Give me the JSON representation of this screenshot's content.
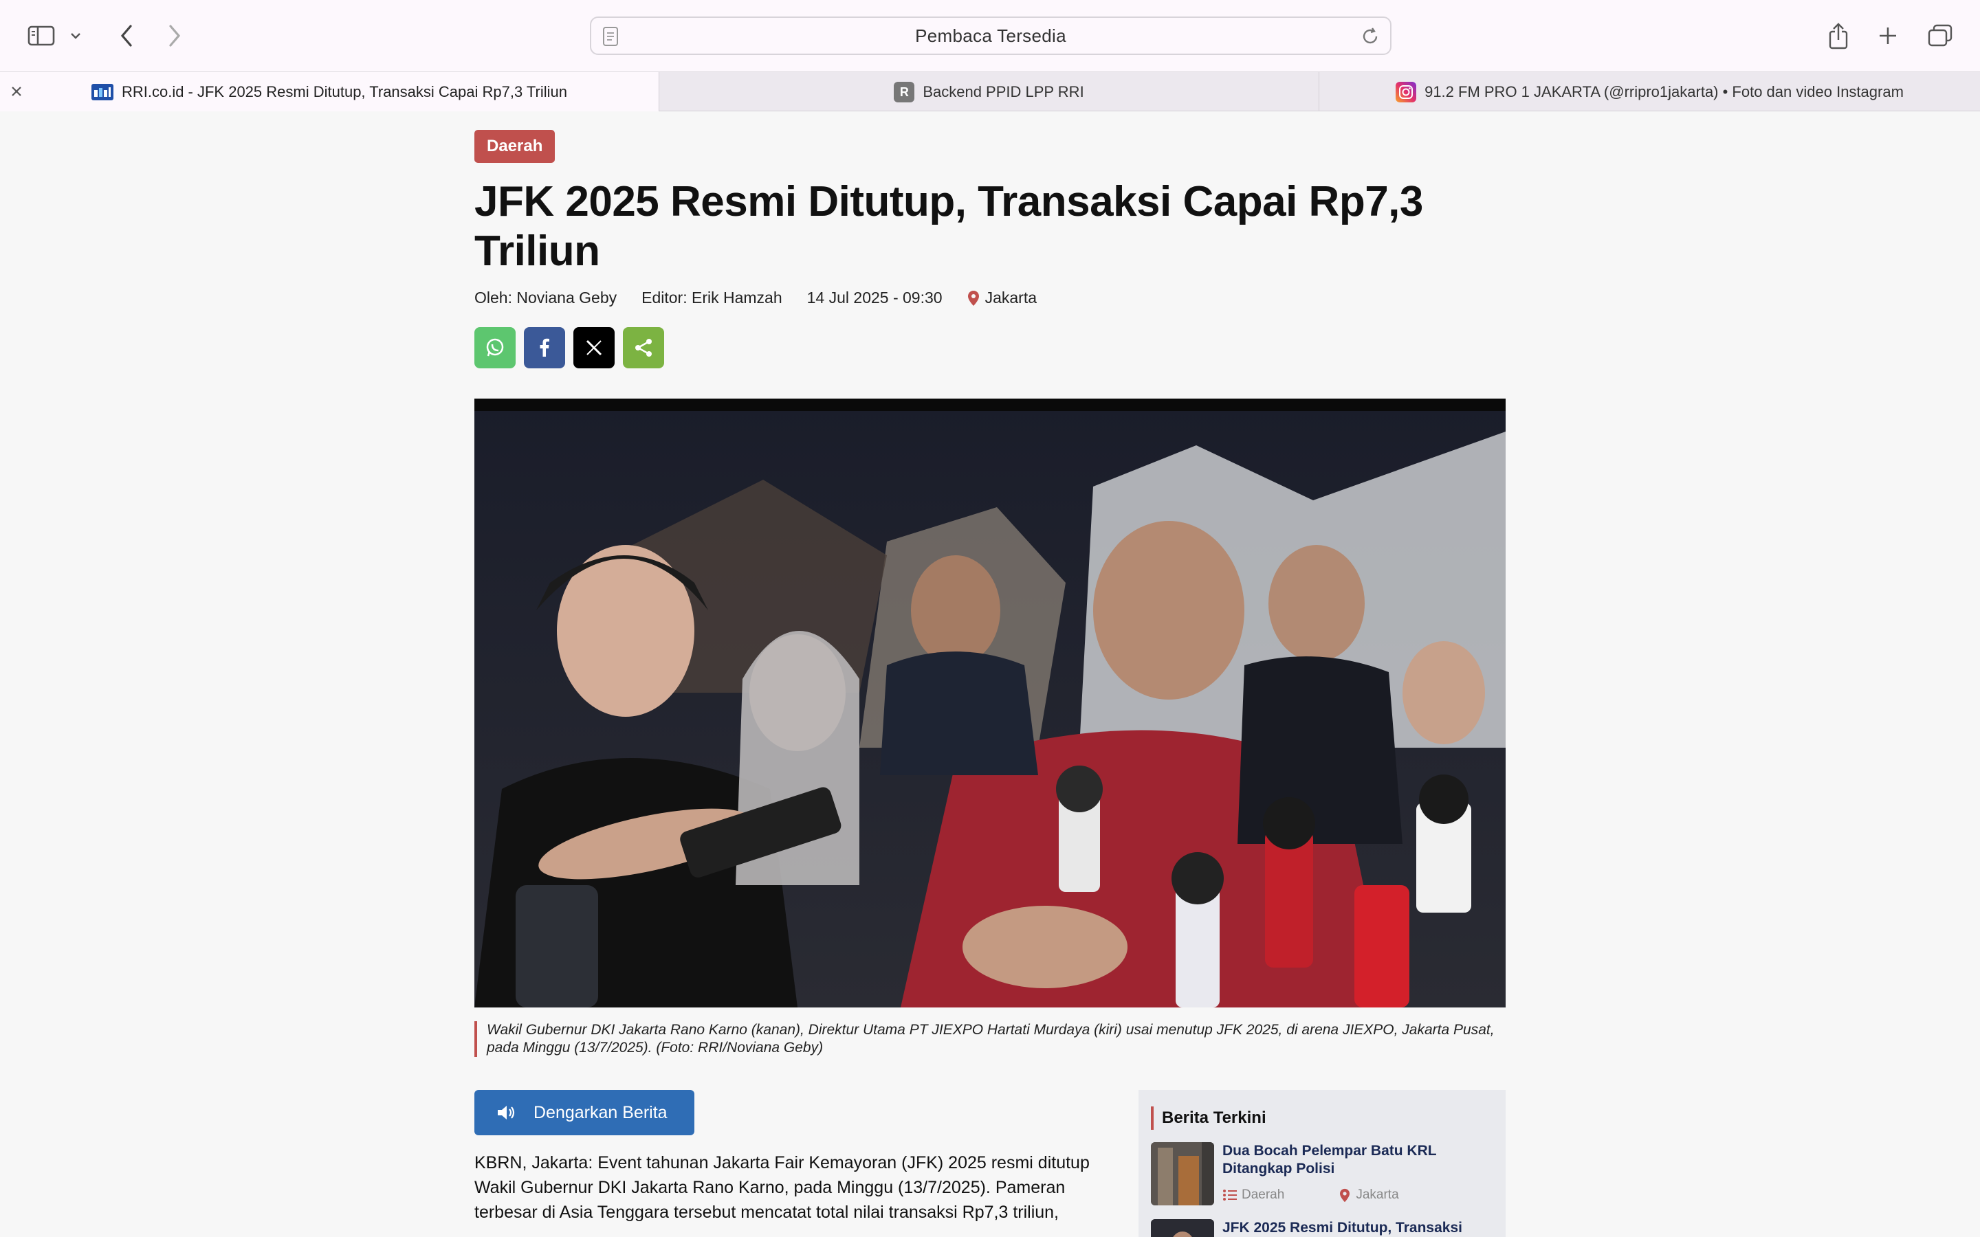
{
  "browser": {
    "address_text": "Pembaca Tersedia",
    "tabs": [
      {
        "title": "RRI.co.id - JFK 2025 Resmi Ditutup, Transaksi Capai Rp7,3 Triliun",
        "favicon": "rri-logo"
      },
      {
        "title": "Backend PPID LPP RRI",
        "favicon": "R"
      },
      {
        "title": "91.2 FM PRO 1 JAKARTA (@rripro1jakarta) • Foto dan video Instagram",
        "favicon": "instagram-logo"
      }
    ]
  },
  "article": {
    "category": "Daerah",
    "title": "JFK 2025 Resmi Ditutup, Transaksi Capai Rp7,3 Triliun",
    "author": "Oleh: Noviana Geby",
    "editor": "Editor: Erik Hamzah",
    "date": "14 Jul 2025 - 09:30",
    "location": "Jakarta",
    "caption": "Wakil Gubernur DKI Jakarta Rano Karno (kanan), Direktur Utama PT JIEXPO Hartati Murdaya (kiri) usai menutup JFK 2025, di arena JIEXPO, Jakarta Pusat, pada Minggu (13/7/2025). (Foto: RRI/Noviana Geby)",
    "listen_label": "Dengarkan Berita",
    "body": "KBRN, Jakarta: Event tahunan Jakarta Fair Kemayoran (JFK) 2025 resmi ditutup Wakil Gubernur DKI Jakarta Rano Karno, pada Minggu (13/7/2025). Pameran terbesar di Asia Tenggara tersebut mencatat total nilai transaksi Rp7,3 triliun,"
  },
  "sidebar": {
    "heading": "Berita Terkini",
    "items": [
      {
        "title": "Dua Bocah Pelempar Batu KRL Ditangkap Polisi",
        "category": "Daerah",
        "location": "Jakarta"
      },
      {
        "title": "JFK 2025 Resmi Ditutup, Transaksi",
        "category": "",
        "location": ""
      }
    ]
  },
  "colors": {
    "accent_red": "#c0504d",
    "listen_blue": "#2f6db5",
    "whatsapp": "#5dc66f",
    "facebook": "#3b5998",
    "twitter": "#000000",
    "share": "#7cb342"
  }
}
